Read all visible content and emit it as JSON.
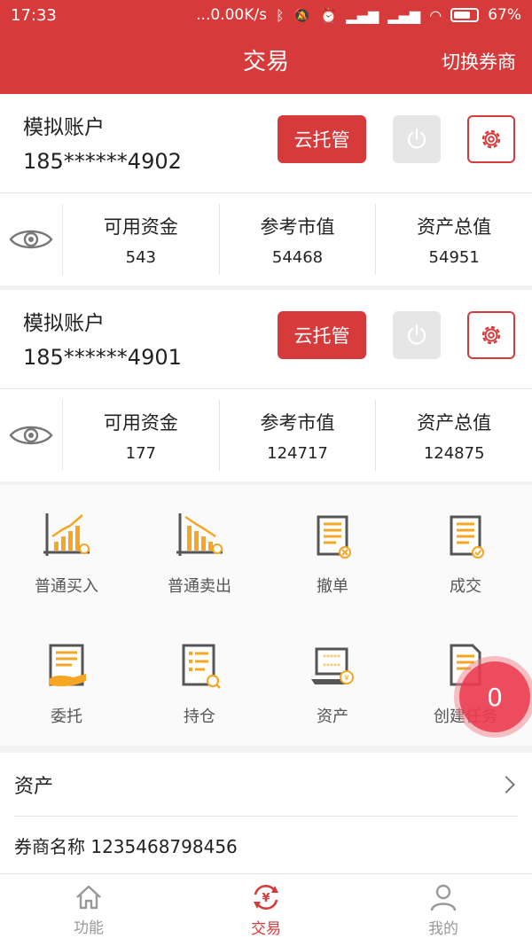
{
  "status_bar": {
    "time": "17:33",
    "network_speed": "...0.00K/s",
    "battery": "67%",
    "icons": [
      "bluetooth-icon",
      "mute-icon",
      "alarm-icon",
      "signal-icon",
      "signal-icon",
      "wifi-icon",
      "battery-icon"
    ]
  },
  "header": {
    "title": "交易",
    "switch_label": "切换券商"
  },
  "accounts": [
    {
      "name": "模拟账户",
      "number": "185******4902",
      "cloud_label": "云托管",
      "stats": [
        {
          "label": "可用资金",
          "value": "543"
        },
        {
          "label": "参考市值",
          "value": "54468"
        },
        {
          "label": "资产总值",
          "value": "54951"
        }
      ]
    },
    {
      "name": "模拟账户",
      "number": "185******4901",
      "cloud_label": "云托管",
      "stats": [
        {
          "label": "可用资金",
          "value": "177"
        },
        {
          "label": "参考市值",
          "value": "124717"
        },
        {
          "label": "资产总值",
          "value": "124875"
        }
      ]
    }
  ],
  "menu": [
    {
      "label": "普通买入",
      "icon": "chart-up-icon"
    },
    {
      "label": "普通卖出",
      "icon": "chart-down-icon"
    },
    {
      "label": "撤单",
      "icon": "cancel-order-icon"
    },
    {
      "label": "成交",
      "icon": "deal-icon"
    },
    {
      "label": "委托",
      "icon": "entrust-icon"
    },
    {
      "label": "持仓",
      "icon": "position-icon"
    },
    {
      "label": "资产",
      "icon": "asset-icon"
    },
    {
      "label": "创建任务",
      "icon": "create-task-icon"
    }
  ],
  "float_badge": "0",
  "assets": {
    "title": "资产",
    "broker_label": "券商名称 1235468798456"
  },
  "tabs": [
    {
      "label": "功能",
      "icon": "home-icon",
      "active": false
    },
    {
      "label": "交易",
      "icon": "trade-icon",
      "active": true
    },
    {
      "label": "我的",
      "icon": "user-icon",
      "active": false
    }
  ],
  "colors": {
    "accent": "#d63a3a",
    "icon_orange": "#f5a623",
    "icon_gray": "#555555"
  }
}
